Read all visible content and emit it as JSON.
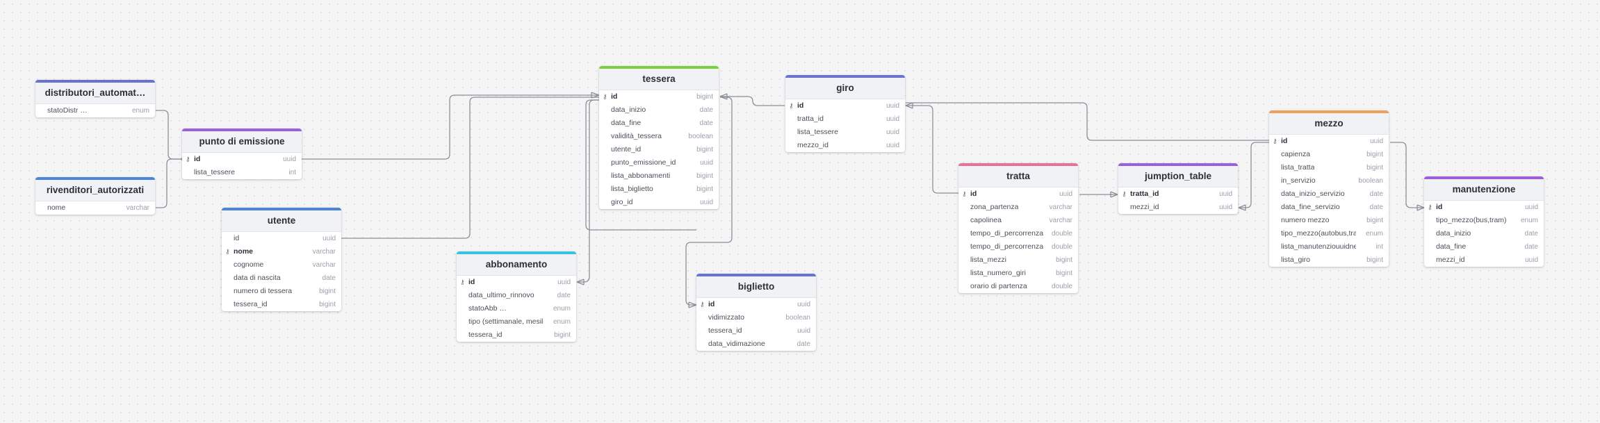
{
  "colors": {
    "purple": "#6b72cf",
    "violet": "#9b5fd9",
    "blue": "#4a86d8",
    "green": "#7ccf3a",
    "cyan": "#38c1e0",
    "pink": "#e8709b",
    "orange": "#eda05a",
    "wire": "#8a8f99"
  },
  "icons": {
    "key": "key-icon"
  },
  "tables": {
    "distributori": {
      "title": "distributori_automat…",
      "columns": [
        {
          "name": "statoDistr …",
          "type": "enum"
        }
      ]
    },
    "rivenditori": {
      "title": "rivenditori_autorizzati",
      "columns": [
        {
          "name": "nome",
          "type": "varchar"
        }
      ]
    },
    "punto": {
      "title": "punto di emissione",
      "columns": [
        {
          "name": "id",
          "type": "uuid",
          "pk": true
        },
        {
          "name": "lista_tessere",
          "type": "int"
        }
      ]
    },
    "utente": {
      "title": "utente",
      "columns": [
        {
          "name": "id",
          "type": "uuid"
        },
        {
          "name": "nome",
          "type": "varchar",
          "pk": true
        },
        {
          "name": "cognome",
          "type": "varchar"
        },
        {
          "name": "data di nascita",
          "type": "date"
        },
        {
          "name": "numero di tessera",
          "type": "bigint"
        },
        {
          "name": "tessera_id",
          "type": "bigint"
        }
      ]
    },
    "abbonamento": {
      "title": "abbonamento",
      "columns": [
        {
          "name": "id",
          "type": "uuid",
          "pk": true
        },
        {
          "name": "data_ultimo_rinnovo",
          "type": "date"
        },
        {
          "name": "statoAbb …",
          "type": "enum"
        },
        {
          "name": "tipo (settimanale, mesile",
          "type": "enum"
        },
        {
          "name": "tessera_id",
          "type": "bigint"
        }
      ]
    },
    "tessera": {
      "title": "tessera",
      "columns": [
        {
          "name": "id",
          "type": "bigint",
          "pk": true
        },
        {
          "name": "data_inizio",
          "type": "date"
        },
        {
          "name": "data_fine",
          "type": "date"
        },
        {
          "name": "validità_tessera",
          "type": "boolean"
        },
        {
          "name": "utente_id",
          "type": "bigint"
        },
        {
          "name": "punto_emissione_id",
          "type": "uuid"
        },
        {
          "name": "lista_abbonamenti",
          "type": "bigint"
        },
        {
          "name": "lista_biglietto",
          "type": "bigint"
        },
        {
          "name": "giro_id",
          "type": "uuid"
        }
      ]
    },
    "biglietto": {
      "title": "biglietto",
      "columns": [
        {
          "name": "id",
          "type": "uuid",
          "pk": true
        },
        {
          "name": "vidimizzato",
          "type": "boolean"
        },
        {
          "name": "tessera_id",
          "type": "uuid"
        },
        {
          "name": "data_vidimazione",
          "type": "date"
        }
      ]
    },
    "giro": {
      "title": "giro",
      "columns": [
        {
          "name": "id",
          "type": "uuid",
          "pk": true
        },
        {
          "name": "tratta_id",
          "type": "uuid"
        },
        {
          "name": "lista_tessere",
          "type": "uuid"
        },
        {
          "name": "mezzo_id",
          "type": "uuid"
        }
      ]
    },
    "tratta": {
      "title": "tratta",
      "columns": [
        {
          "name": "id",
          "type": "uuid",
          "pk": true
        },
        {
          "name": "zona_partenza",
          "type": "varchar"
        },
        {
          "name": "capolinea",
          "type": "varchar"
        },
        {
          "name": "tempo_di_percorrenza",
          "type": "double"
        },
        {
          "name": "tempo_di_percorrenza",
          "type": "double"
        },
        {
          "name": "lista_mezzi",
          "type": "bigint"
        },
        {
          "name": "lista_numero_giri",
          "type": "bigint"
        },
        {
          "name": "orario di partenza",
          "type": "double"
        }
      ]
    },
    "jumption": {
      "title": "jumption_table",
      "columns": [
        {
          "name": "tratta_id",
          "type": "uuid",
          "pk": true
        },
        {
          "name": "mezzi_id",
          "type": "uuid"
        }
      ]
    },
    "mezzo": {
      "title": "mezzo",
      "columns": [
        {
          "name": "id",
          "type": "uuid",
          "pk": true
        },
        {
          "name": "capienza",
          "type": "bigint"
        },
        {
          "name": "lista_tratta",
          "type": "bigint"
        },
        {
          "name": "in_servizio",
          "type": "boolean"
        },
        {
          "name": "data_inizio_servizio",
          "type": "date"
        },
        {
          "name": "data_fine_servizio",
          "type": "date"
        },
        {
          "name": "numero mezzo",
          "type": "bigint"
        },
        {
          "name": "tipo_mezzo(autobus,tram",
          "type": "enum"
        },
        {
          "name": "lista_manutenziouuidne",
          "type": "int"
        },
        {
          "name": "lista_giro",
          "type": "bigint"
        }
      ]
    },
    "manutenzione": {
      "title": "manutenzione",
      "columns": [
        {
          "name": "id",
          "type": "uuid",
          "pk": true
        },
        {
          "name": "tipo_mezzo(bus,tram)",
          "type": "enum"
        },
        {
          "name": "data_inizio",
          "type": "date"
        },
        {
          "name": "data_fine",
          "type": "date"
        },
        {
          "name": "mezzi_id",
          "type": "uuid"
        }
      ]
    }
  }
}
